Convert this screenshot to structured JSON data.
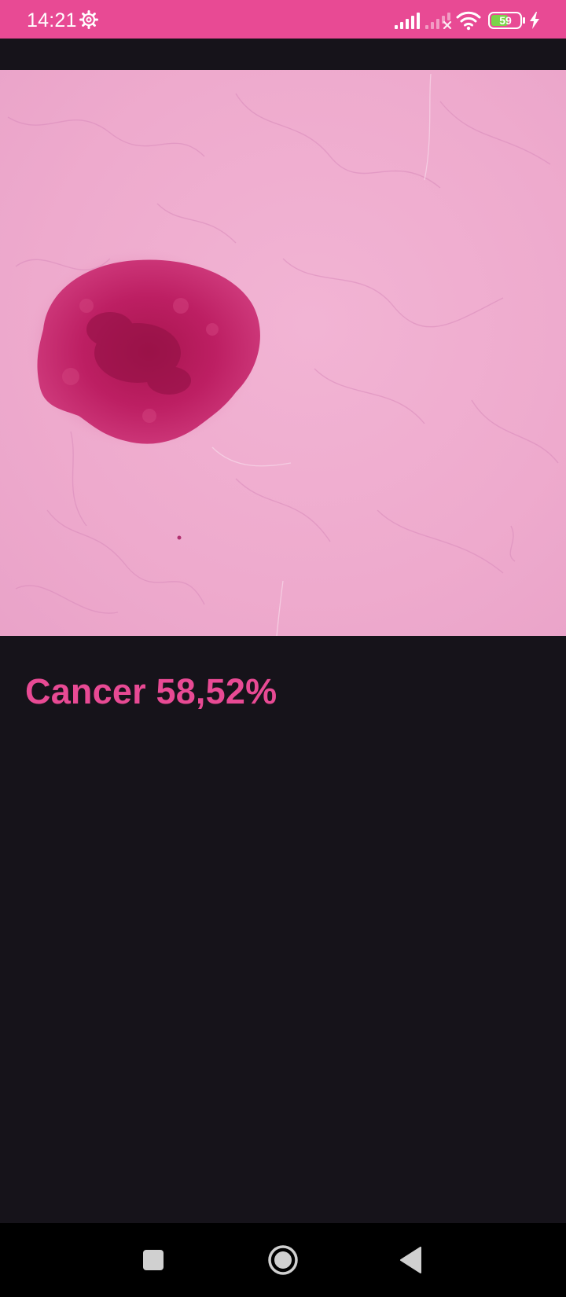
{
  "status_bar": {
    "time": "14:21",
    "battery_level": "59",
    "settings_icon": "gear-icon",
    "signal_icon": "cellular-signal-icon",
    "signal2_icon": "cellular-no-signal-icon",
    "wifi_icon": "wifi-icon",
    "charging_icon": "bolt-icon",
    "background_color": "#e84a94"
  },
  "image": {
    "content": "dermoscopy-skin-lesion-image"
  },
  "result": {
    "label": "Cancer 58,52%",
    "color": "#e84a94"
  },
  "nav_bar": {
    "recent_icon": "square-recent-apps-icon",
    "home_icon": "circle-home-icon",
    "back_icon": "triangle-back-icon"
  }
}
